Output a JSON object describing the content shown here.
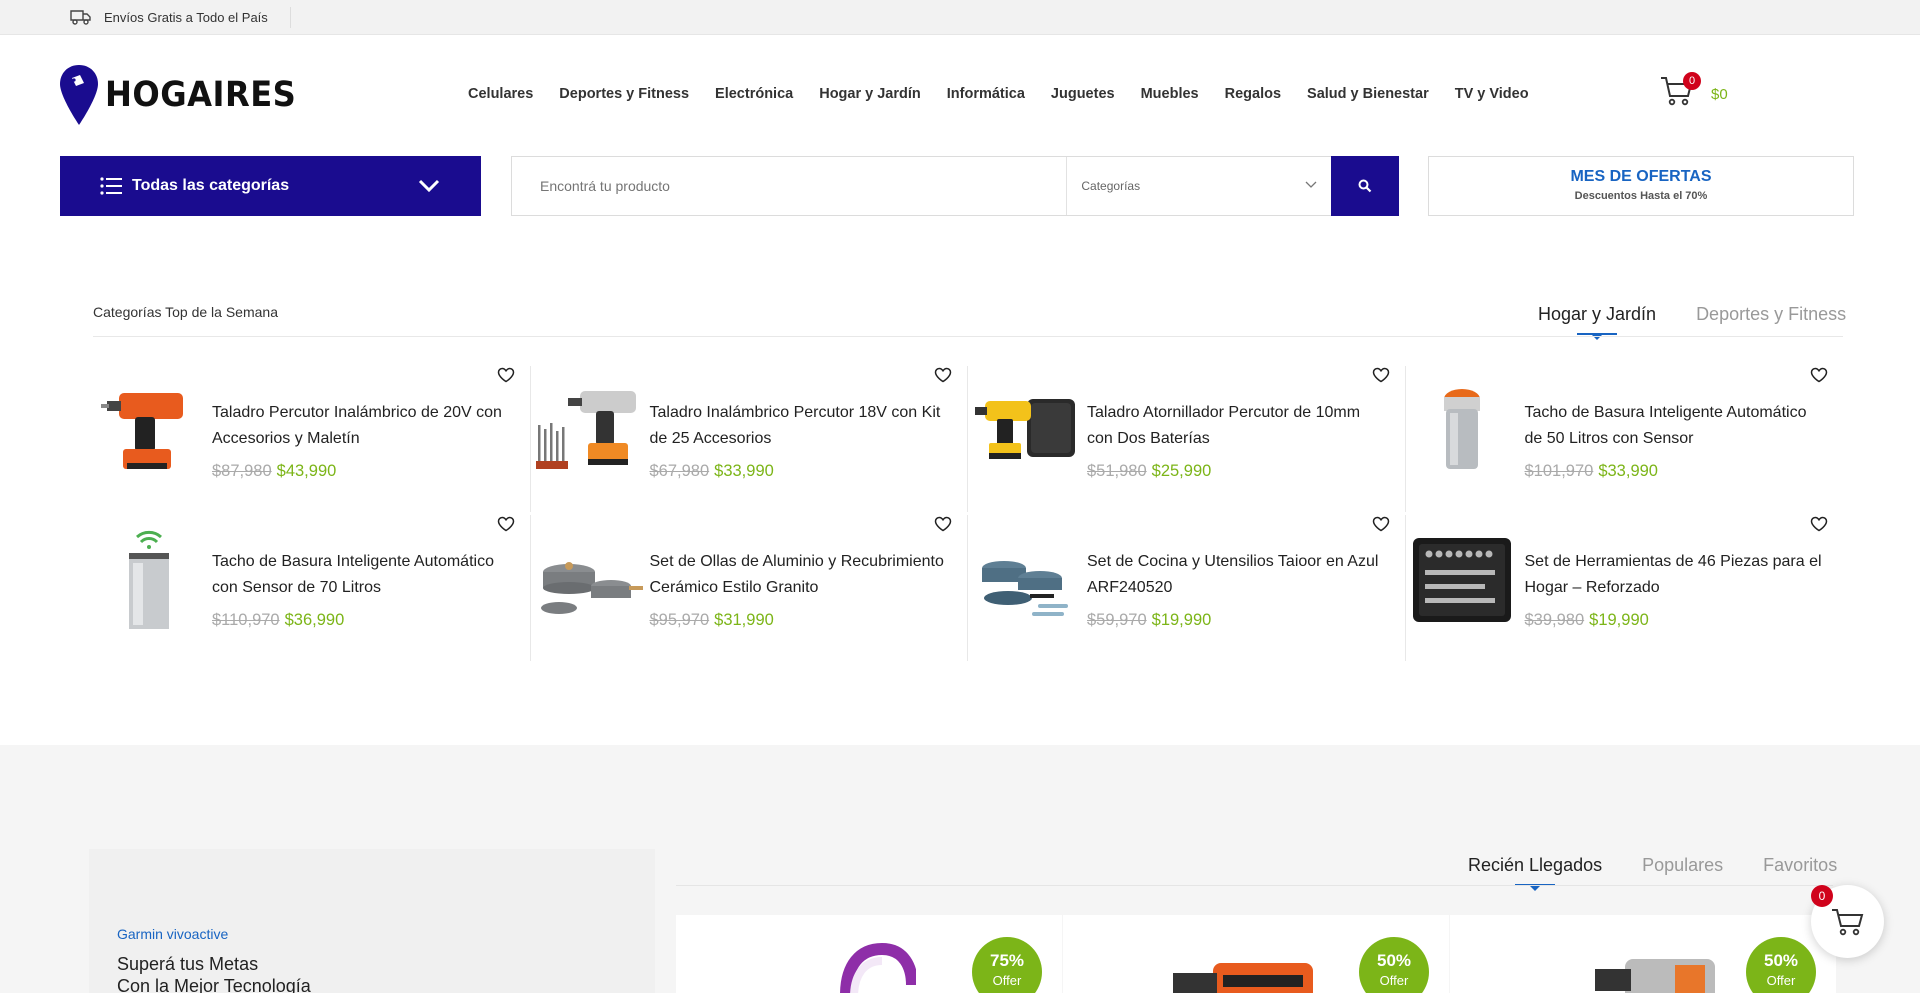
{
  "topbar": {
    "shipping_text": "Envíos Gratis a Todo el País"
  },
  "brand": {
    "name": "HOGAIRES"
  },
  "nav": [
    "Celulares",
    "Deportes y Fitness",
    "Electrónica",
    "Hogar y Jardín",
    "Informática",
    "Juguetes",
    "Muebles",
    "Regalos",
    "Salud y Bienestar",
    "TV y Video"
  ],
  "cart": {
    "count": "0",
    "total": "$0"
  },
  "all_categories": {
    "label": "Todas las categorías"
  },
  "search": {
    "placeholder": "Encontrá tu producto",
    "category_label": "Categorías"
  },
  "promo": {
    "title": "MES DE OFERTAS",
    "subtitle": "Descuentos Hasta el 70%"
  },
  "top_week": {
    "title": "Categorías Top de la Semana",
    "tabs": [
      "Hogar y Jardín",
      "Deportes y Fitness"
    ],
    "active_tab": "Hogar y Jardín",
    "products": [
      {
        "name": "Taladro Percutor Inalámbrico de 20V con Accesorios y Maletín",
        "old": "$87,980",
        "new": "$43,990",
        "image": "drill-orange"
      },
      {
        "name": "Taladro Inalámbrico Percutor 18V con Kit de 25 Accesorios",
        "old": "$67,980",
        "new": "$33,990",
        "image": "drill-grey-kit"
      },
      {
        "name": "Taladro Atornillador Percutor de 10mm con Dos Baterías",
        "old": "$51,980",
        "new": "$25,990",
        "image": "drill-yellow-case"
      },
      {
        "name": "Tacho de Basura Inteligente Automático de 50 Litros con Sensor",
        "old": "$101,970",
        "new": "$33,990",
        "image": "bin-round"
      },
      {
        "name": "Tacho de Basura Inteligente Automático con Sensor de 70 Litros",
        "old": "$110,970",
        "new": "$36,990",
        "image": "bin-wifi"
      },
      {
        "name": "Set de Ollas de Aluminio y Recubrimiento Cerámico Estilo Granito",
        "old": "$95,970",
        "new": "$31,990",
        "image": "pots-grey"
      },
      {
        "name": "Set de Cocina y Utensilios Taioor en Azul ARF240520",
        "old": "$59,970",
        "new": "$19,990",
        "image": "pots-blue"
      },
      {
        "name": "Set de Herramientas de 46 Piezas para el Hogar – Reforzado",
        "old": "$39,980",
        "new": "$19,990",
        "image": "toolbox"
      }
    ]
  },
  "feature": {
    "brand": "Garmin vivoactive",
    "line1": "Superá tus Metas",
    "line2": "Con la Mejor Tecnología"
  },
  "arrivals": {
    "tabs": [
      "Recién Llegados",
      "Populares",
      "Favoritos"
    ],
    "active_tab": "Recién Llegados",
    "cards": [
      {
        "percent": "75%",
        "label": "Offer"
      },
      {
        "percent": "50%",
        "label": "Offer"
      },
      {
        "percent": "50%",
        "label": "Offer"
      }
    ]
  },
  "floating_cart": {
    "count": "0"
  },
  "colors": {
    "primary": "#1a0c8f",
    "accent_blue": "#1864c2",
    "price_green": "#7cb518",
    "badge_red": "#d0021b"
  }
}
